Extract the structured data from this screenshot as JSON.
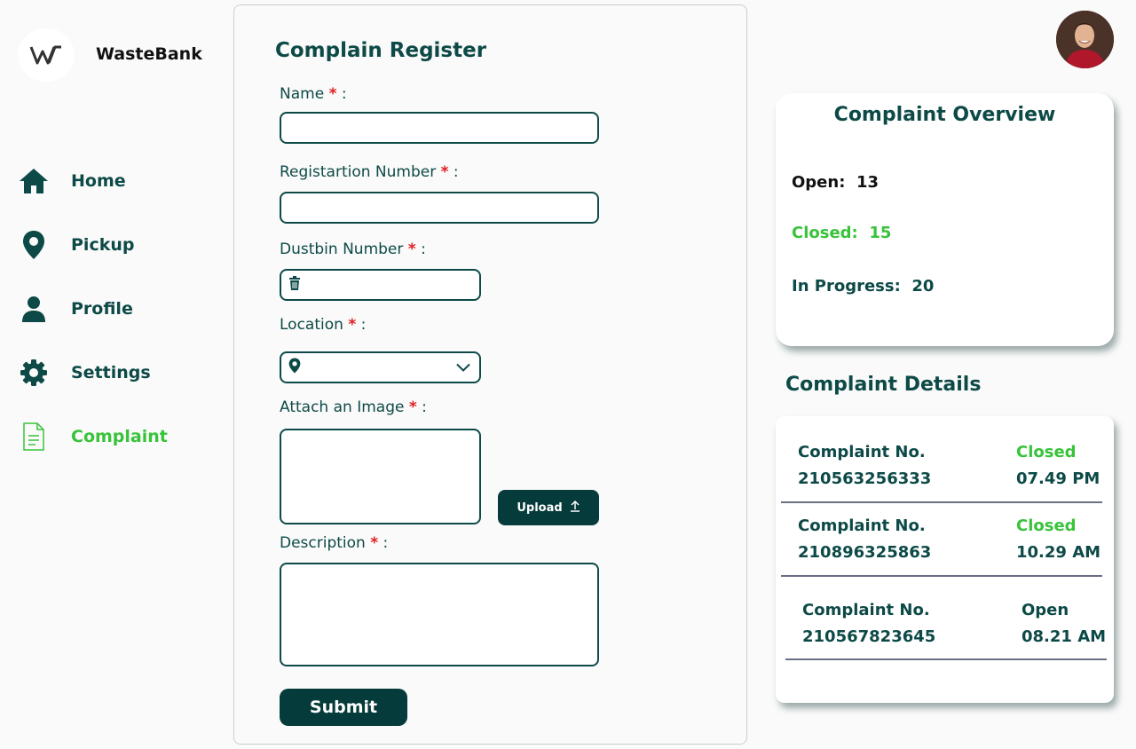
{
  "brand": {
    "name": "WasteBank",
    "logo_icon": "wastebank-logo-icon"
  },
  "nav": [
    {
      "label": "Home",
      "icon": "home-icon"
    },
    {
      "label": "Pickup",
      "icon": "location-pin-icon"
    },
    {
      "label": "Profile",
      "icon": "user-icon"
    },
    {
      "label": "Settings",
      "icon": "gear-icon"
    },
    {
      "label": "Complaint",
      "icon": "document-icon",
      "active": true
    }
  ],
  "form": {
    "title": "Complain Register",
    "name_label": "Name",
    "reg_label": "Registartion Number",
    "dustbin_label": "Dustbin  Number",
    "location_label": "Location",
    "image_label": "Attach an Image",
    "description_label": "Description",
    "required_mark": "*",
    "colon": ":",
    "upload_label": "Upload",
    "submit_label": "Submit"
  },
  "overview": {
    "title": "Complaint Overview",
    "open_label": "Open:",
    "open_count": "13",
    "closed_label": "Closed:",
    "closed_count": "15",
    "progress_label": "In Progress:",
    "progress_count": "20"
  },
  "details": {
    "title": "Complaint Details",
    "rows": [
      {
        "label": "Complaint No.",
        "number": "210563256333",
        "status": "Closed",
        "time": "07.49 PM"
      },
      {
        "label": "Complaint No.",
        "number": "210896325863",
        "status": "Closed",
        "time": "10.29 AM"
      },
      {
        "label": "Complaint No.",
        "number": "210567823645",
        "status": "Open",
        "time": "08.21 AM"
      }
    ]
  },
  "colors": {
    "primary": "#0d4a47",
    "dark_button": "#053b3a",
    "accent_green": "#39c33b",
    "required_red": "#e11d1d"
  }
}
